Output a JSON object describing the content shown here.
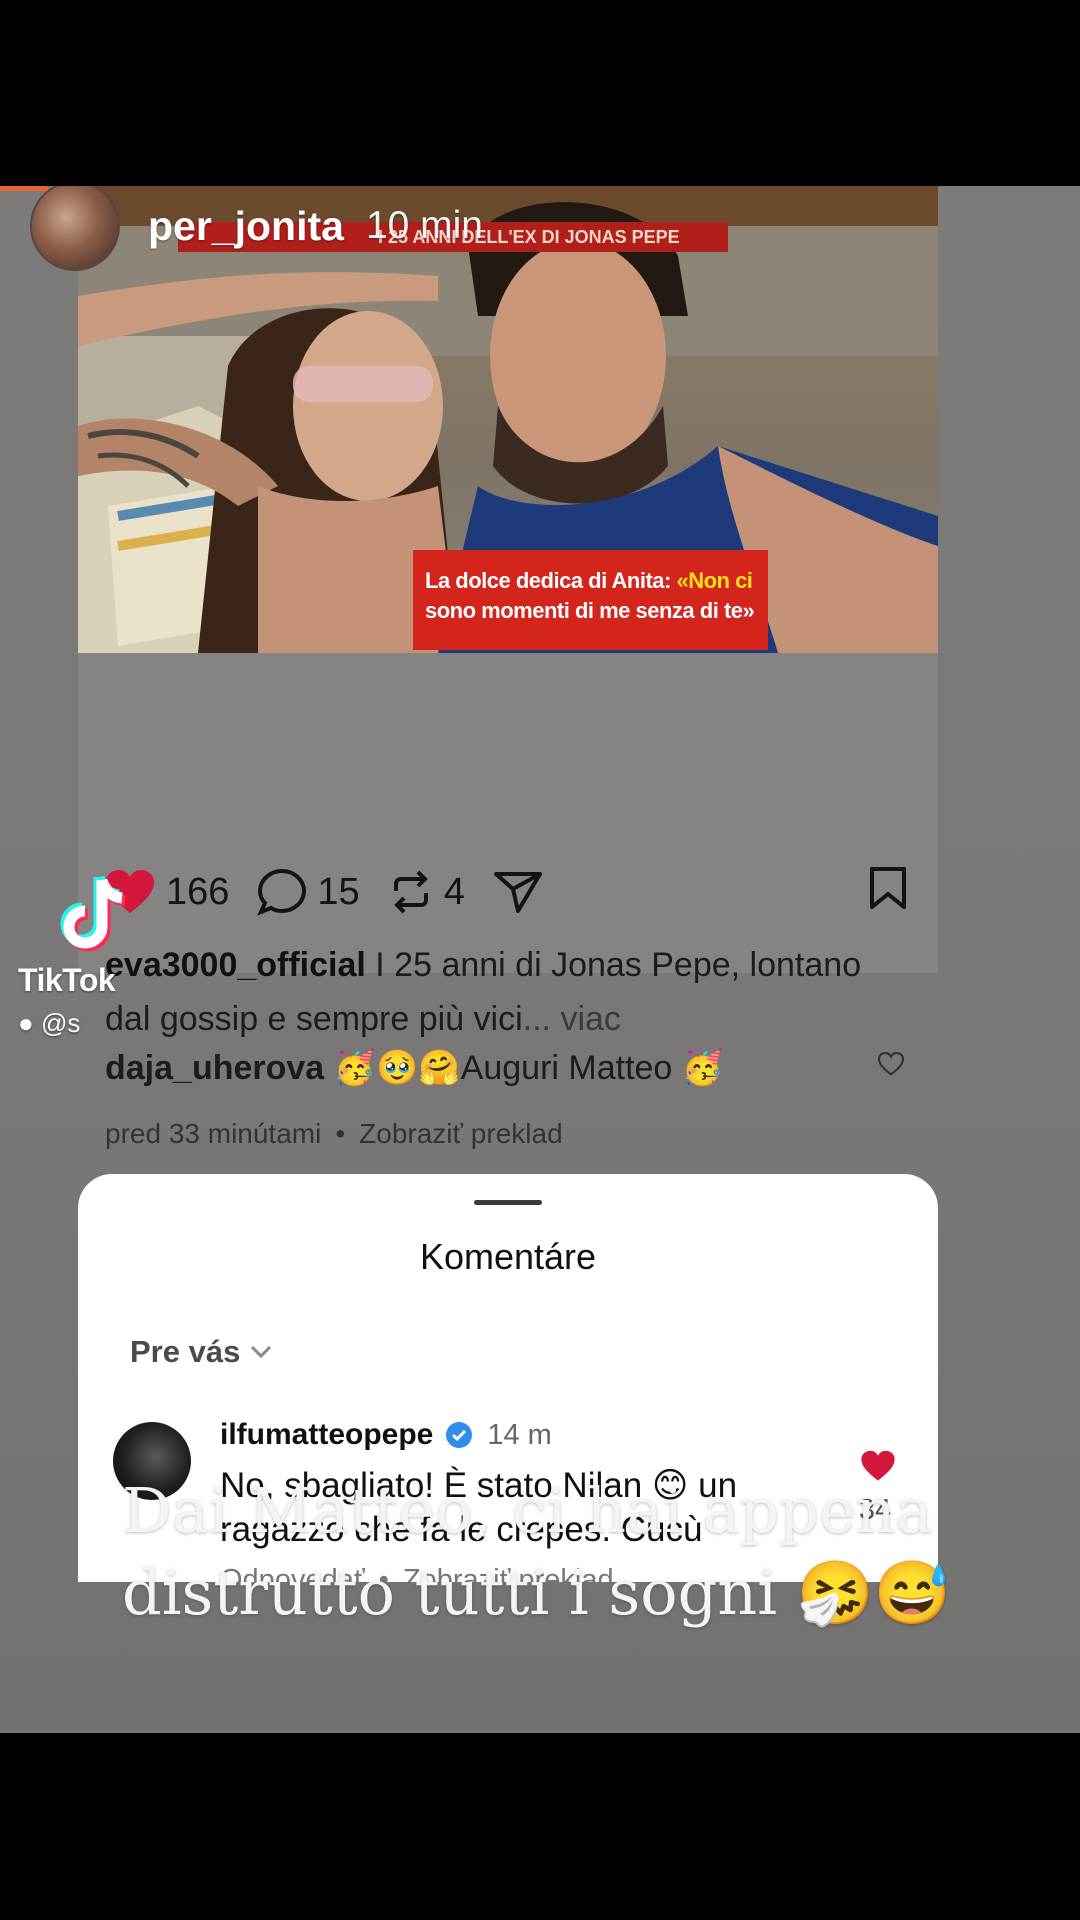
{
  "story": {
    "username": "per_jonita",
    "time": "10 min"
  },
  "post": {
    "banner": "I 25 ANNI DELL'EX DI JONAS PEPE",
    "overlay_line1": "La dolce dedica di Anita: ",
    "overlay_quote1": "«Non ci",
    "overlay_line2": "sono momenti di me senza di te»",
    "likes": "166",
    "comments": "15",
    "reposts": "4",
    "caption_user": "eva3000_official",
    "caption_text": " I 25 anni di Jonas Pepe, lontano dal gossip e sempre più vici",
    "caption_more": "... viac",
    "preview_user": "daja_uherova",
    "preview_text": " 🥳🥹🤗Auguri Matteo 🥳",
    "preview_time": "pred 33 minútami",
    "preview_translate": "Zobraziť preklad"
  },
  "watermark": {
    "brand": "TikTok",
    "handle": "@s"
  },
  "sheet": {
    "title": "Komentáre",
    "filter": "Pre vás",
    "comment": {
      "user": "ilfumatteopepe",
      "time": "14 m",
      "text": "No, sbagliato! È stato Nilan 😊 un ragazzo che fa le crepes. Cucù",
      "likes": "34",
      "reply": "Odpovedať",
      "translate": "Zobraziť preklad"
    }
  },
  "story_text": {
    "line1": "Dai Matteo, ci hai appena",
    "line2": "distrutto tutti i sogni 🤧😅"
  },
  "colors": {
    "heart": "#d5163c",
    "verified": "#2f8ee8",
    "progress": "#e8643a",
    "overlay_red": "#d4251c",
    "overlay_yellow": "#ffe01a"
  }
}
